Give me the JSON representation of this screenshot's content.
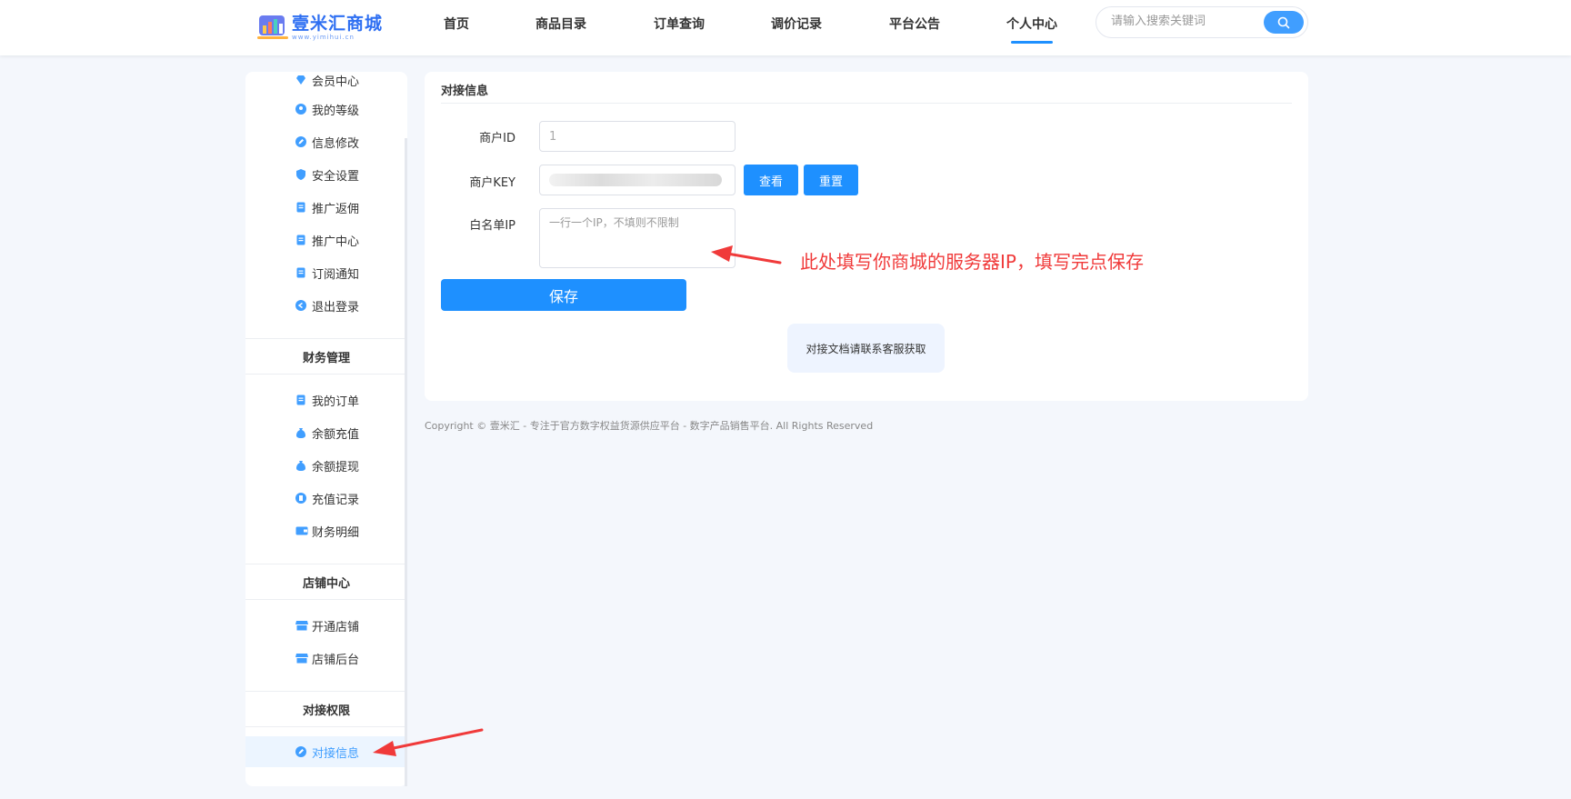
{
  "brand": {
    "title": "壹米汇商城",
    "subtitle": "www.yimihui.cn"
  },
  "nav": {
    "items": [
      {
        "label": "首页"
      },
      {
        "label": "商品目录"
      },
      {
        "label": "订单查询"
      },
      {
        "label": "调价记录"
      },
      {
        "label": "平台公告"
      },
      {
        "label": "个人中心",
        "active": true
      }
    ],
    "search_placeholder": "请输入搜索关键词"
  },
  "sidebar": {
    "personal_items": [
      {
        "label": "会员中心",
        "icon": "vip-icon"
      },
      {
        "label": "我的等级",
        "icon": "level-icon"
      },
      {
        "label": "信息修改",
        "icon": "edit-icon"
      },
      {
        "label": "安全设置",
        "icon": "shield-icon"
      },
      {
        "label": "推广返佣",
        "icon": "clipboard-icon"
      },
      {
        "label": "推广中心",
        "icon": "clipboard-icon"
      },
      {
        "label": "订阅通知",
        "icon": "clipboard-icon"
      },
      {
        "label": "退出登录",
        "icon": "logout-icon"
      }
    ],
    "finance_title": "财务管理",
    "finance_items": [
      {
        "label": "我的订单",
        "icon": "clipboard-icon"
      },
      {
        "label": "余额充值",
        "icon": "money-bag-icon"
      },
      {
        "label": "余额提现",
        "icon": "money-bag-icon"
      },
      {
        "label": "充值记录",
        "icon": "record-icon"
      },
      {
        "label": "财务明细",
        "icon": "wallet-icon"
      }
    ],
    "shop_title": "店铺中心",
    "shop_items": [
      {
        "label": "开通店铺",
        "icon": "store-icon"
      },
      {
        "label": "店铺后台",
        "icon": "store-icon"
      }
    ],
    "api_title": "对接权限",
    "api_items": [
      {
        "label": "对接信息",
        "icon": "edit-icon",
        "active": true
      }
    ]
  },
  "main": {
    "title": "对接信息",
    "merchant_id_label": "商户ID",
    "merchant_id_value": "1",
    "merchant_key_label": "商户KEY",
    "view_button": "查看",
    "reset_button": "重置",
    "whitelist_label": "白名单IP",
    "whitelist_placeholder": "一行一个IP，不填则不限制",
    "save_button": "保存",
    "notice": "对接文档请联系客服获取"
  },
  "annotation": "此处填写你商城的服务器IP，填写完点保存",
  "footer": "Copyright © 壹米汇 - 专注于官方数字权益货源供应平台 - 数字产品销售平台. All Rights Reserved",
  "colors": {
    "accent": "#1e90ff",
    "annotation": "#f03a3a",
    "background": "#f4f7fc"
  }
}
